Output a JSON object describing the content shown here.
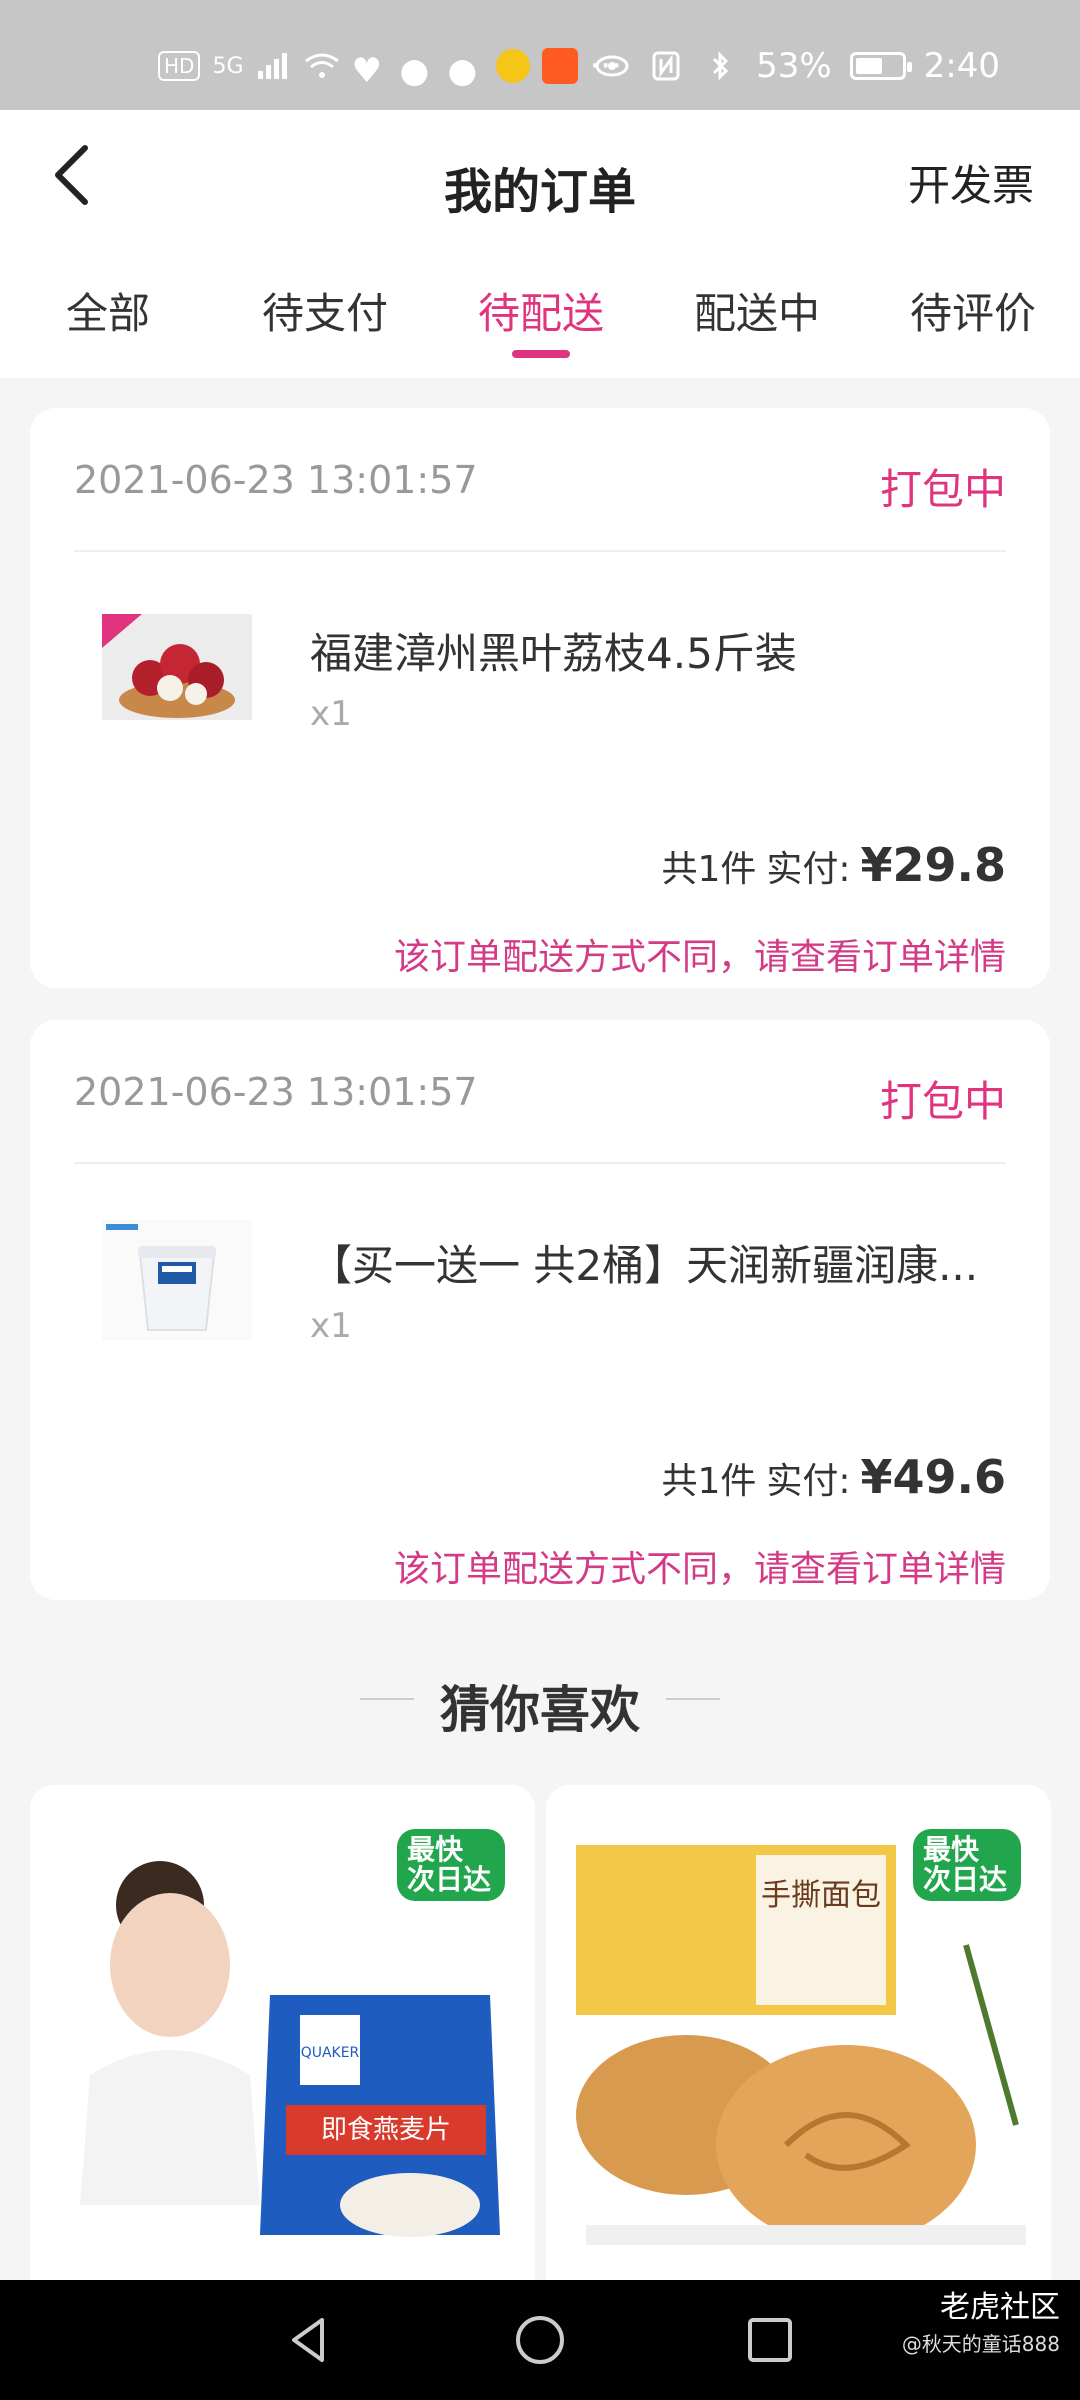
{
  "statusbar": {
    "battery": "53%",
    "time": "2:40",
    "network": "5G"
  },
  "nav": {
    "title": "我的订单",
    "invoice": "开发票"
  },
  "tabs": [
    {
      "label": "全部"
    },
    {
      "label": "待支付"
    },
    {
      "label": "待配送",
      "active": true
    },
    {
      "label": "配送中"
    },
    {
      "label": "待评价"
    }
  ],
  "orders": [
    {
      "time": "2021-06-23 13:01:57",
      "status": "打包中",
      "name": "福建漳州黑叶荔枝4.5斤装",
      "qty": "x1",
      "summary_count": "共1件",
      "paid_label": "实付:",
      "price": "¥29.8",
      "note": "该订单配送方式不同，请查看订单详情",
      "tag": "4.5斤装"
    },
    {
      "time": "2021-06-23 13:01:57",
      "status": "打包中",
      "name": "【买一送一 共2桶】天润新疆润康...",
      "qty": "x1",
      "summary_count": "共1件",
      "paid_label": "实付:",
      "price": "¥49.6",
      "note": "该订单配送方式不同，请查看订单详情"
    }
  ],
  "recommend": {
    "title": "猜你喜欢"
  },
  "products": [
    {
      "badge1": "最快",
      "badge2": "次日达",
      "pack_text": "即食燕麦片",
      "brand": "QUAKER"
    },
    {
      "badge1": "最快",
      "badge2": "次日达",
      "pack_text": "手撕面包"
    }
  ],
  "watermark": {
    "line1": "老虎社区",
    "line2": "@秋天的童话888"
  },
  "colors": {
    "accent": "#e0347e",
    "badge": "#22a64d"
  }
}
